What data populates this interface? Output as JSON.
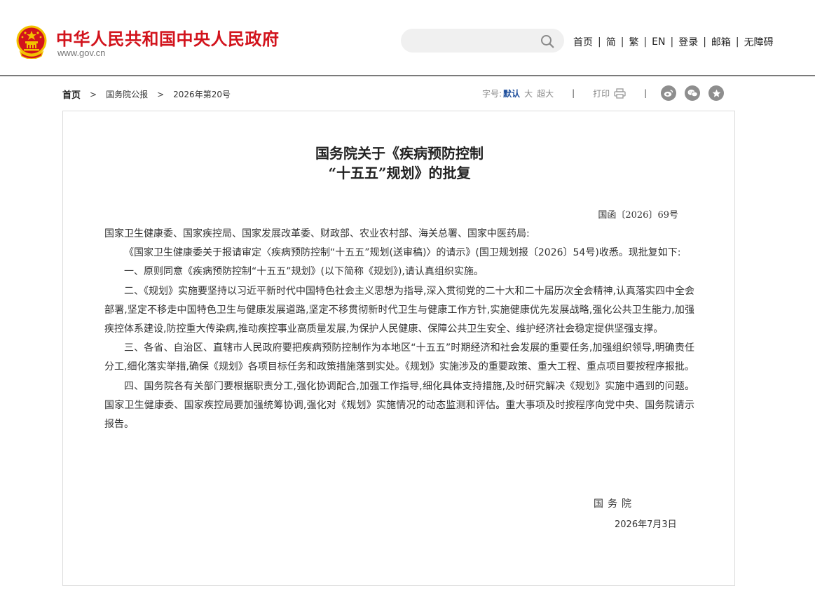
{
  "header": {
    "site_title": "中华人民共和国中央人民政府",
    "domain": "www.gov.cn",
    "search": {
      "placeholder": "",
      "value": ""
    },
    "nav": [
      "首页",
      "简",
      "繁",
      "EN",
      "登录",
      "邮箱",
      "无障碍"
    ],
    "colors": {
      "brand_red": "#d2131c",
      "emblem_gold": "#f2c200"
    }
  },
  "breadcrumb": {
    "home": "首页",
    "items": [
      "国务院公报",
      "2026年第20号"
    ]
  },
  "toolbar": {
    "font_size_label": "字号:",
    "font_sizes": [
      "默认",
      "大",
      "超大"
    ],
    "active_font_size": "默认",
    "print_label": "打印",
    "share_icons": [
      "weibo-icon",
      "wechat-icon",
      "favorite-star-icon"
    ]
  },
  "document": {
    "title_line1": "国务院关于《疾病预防控制",
    "title_line2": "“十五五”规划》的批复",
    "doc_number": "国函〔2026〕69号",
    "recipients": "国家卫生健康委、国家疾控局、国家发展改革委、财政部、农业农村部、海关总署、国家中医药局:",
    "paragraphs": [
      "《国家卫生健康委关于报请审定〈疾病预防控制“十五五”规划(送审稿)〉的请示》(国卫规划报〔2026〕54号)收悉。现批复如下:",
      "一、原则同意《疾病预防控制“十五五”规划》(以下简称《规划》),请认真组织实施。",
      "二、《规划》实施要坚持以习近平新时代中国特色社会主义思想为指导,深入贯彻党的二十大和二十届历次全会精神,认真落实四中全会部署,坚定不移走中国特色卫生与健康发展道路,坚定不移贯彻新时代卫生与健康工作方针,实施健康优先发展战略,强化公共卫生能力,加强疾控体系建设,防控重大传染病,推动疾控事业高质量发展,为保护人民健康、保障公共卫生安全、维护经济社会稳定提供坚强支撑。",
      "三、各省、自治区、直辖市人民政府要把疾病预防控制作为本地区“十五五”时期经济和社会发展的重要任务,加强组织领导,明确责任分工,细化落实举措,确保《规划》各项目标任务和政策措施落到实处。《规划》实施涉及的重要政策、重大工程、重点项目要按程序报批。",
      "四、国务院各有关部门要根据职责分工,强化协调配合,加强工作指导,细化具体支持措施,及时研究解决《规划》实施中遇到的问题。国家卫生健康委、国家疾控局要加强统筹协调,强化对《规划》实施情况的动态监测和评估。重大事项及时按程序向党中央、国务院请示报告。"
    ],
    "signature": "国务院",
    "date": "2026年7月3日"
  }
}
